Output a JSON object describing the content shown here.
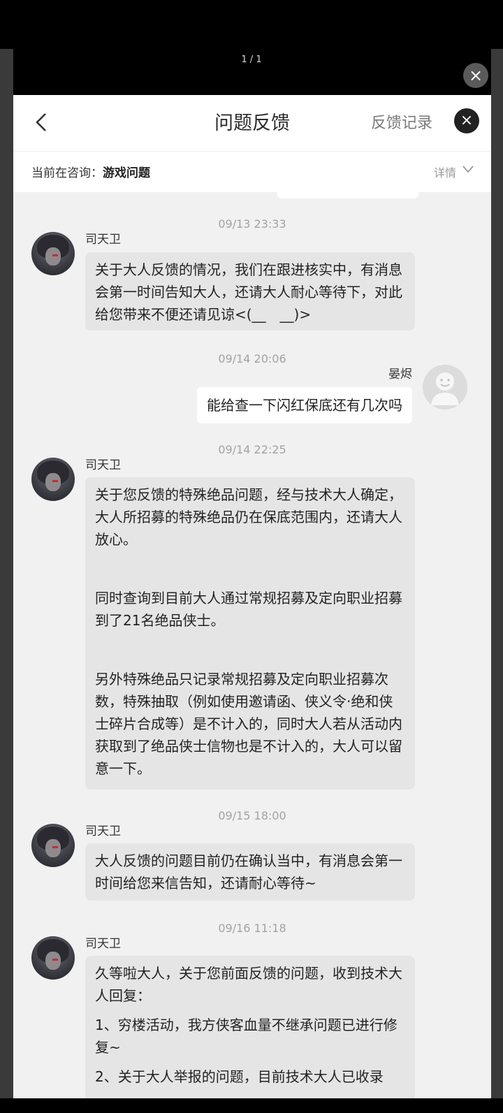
{
  "viewer": {
    "page_indicator": "1 / 1",
    "close_icon": "×"
  },
  "header": {
    "title": "问题反馈",
    "records_label": "反馈记录",
    "close_icon": "×"
  },
  "subheader": {
    "consult_prefix": "当前在咨询：",
    "consult_value": "游戏问题",
    "details_label": "详情"
  },
  "messages": [
    {
      "timestamp": "09/13 23:33",
      "sender": "司天卫",
      "paragraphs": [
        "关于大人反馈的情况，我们在跟进核实中，有消息会第一时间告知大人，还请大人耐心等待下，对此给您带来不便还请见谅<(__　__)>"
      ]
    },
    {
      "timestamp": "09/14 20:06",
      "sender": "晏烬",
      "text": "能给查一下闪红保底还有几次吗"
    },
    {
      "timestamp": "09/14 22:25",
      "sender": "司天卫",
      "paragraphs": [
        "关于您反馈的特殊绝品问题，经与技术大人确定，大人所招募的特殊绝品仍在保底范围内，还请大人放心。",
        "同时查询到目前大人通过常规招募及定向职业招募到了21名绝品侠士。",
        "另外特殊绝品只记录常规招募及定向职业招募次数，特殊抽取（例如使用邀请函、侠义令·绝和侠士碎片合成等）是不计入的，同时大人若从活动内获取到了绝品侠士信物也是不计入的，大人可以留意一下。"
      ]
    },
    {
      "timestamp": "09/15 18:00",
      "sender": "司天卫",
      "paragraphs": [
        "大人反馈的问题目前仍在确认当中，有消息会第一时间给您来信告知，还请耐心等待~"
      ]
    },
    {
      "timestamp": "09/16 11:18",
      "sender": "司天卫",
      "paragraphs": [
        "久等啦大人，关于您前面反馈的问题，收到技术大人回复：",
        "1、穷楼活动，我方侠客血量不继承问题已进行修复~",
        "2、关于大人举报的问题，目前技术大人已收录"
      ]
    }
  ]
}
